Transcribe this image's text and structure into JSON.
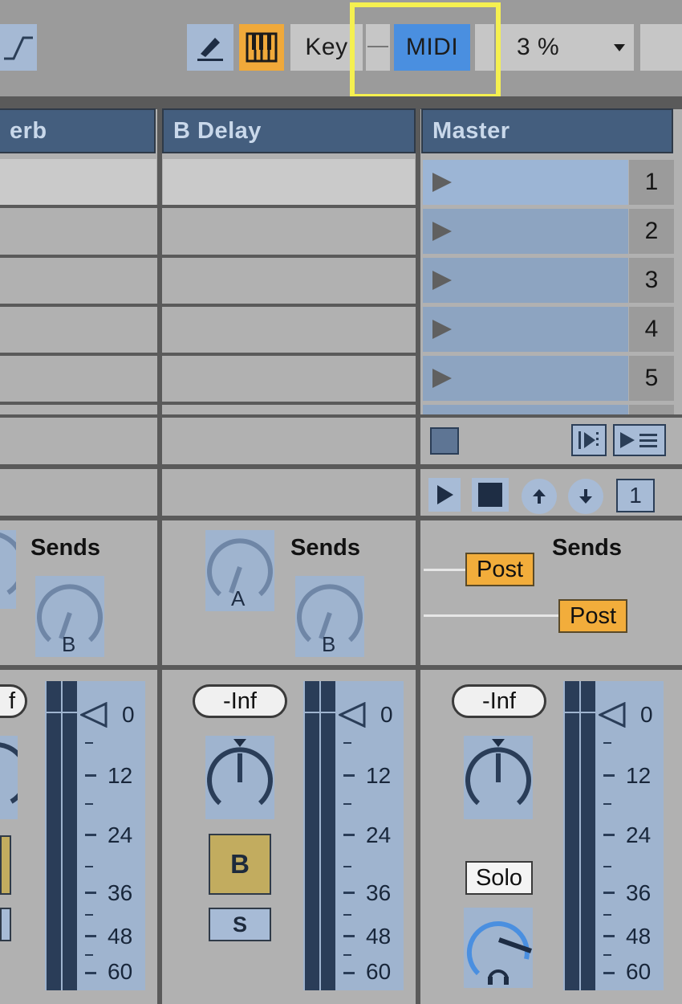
{
  "toolbar": {
    "draw_icon": "pencil-icon",
    "keyboard_icon": "piano-keys-icon",
    "envelope_icon": "curve-icon",
    "key_label": "Key",
    "midi_label": "MIDI",
    "percent_value": "3 %",
    "colors": {
      "midi_bg": "#4a8fe0",
      "keys_bg": "#f0a93a",
      "highlight": "#f5f050"
    }
  },
  "tracks": {
    "a_return_title_partial": "erb",
    "b_delay_title": "B Delay",
    "master_title": "Master"
  },
  "scenes": [
    "1",
    "2",
    "3",
    "4",
    "5"
  ],
  "master_controls": {
    "stop_all_icon": "stop-square-icon",
    "launch_scene_icon": "launch-scene-icon",
    "follow_icon": "play-list-icon",
    "play_icon": "play-icon",
    "stop_icon": "stop-icon",
    "up_icon": "arrow-up-icon",
    "down_icon": "arrow-down-icon",
    "scene_value": "1"
  },
  "sends": {
    "label": "Sends",
    "knob_a": "A",
    "knob_b": "B",
    "post_label": "Post"
  },
  "mixer": {
    "inf_partial": "f",
    "inf": "-Inf",
    "scale": [
      "0",
      "12",
      "24",
      "36",
      "48",
      "60"
    ],
    "crossfade_b": "B",
    "solo_s": "S",
    "solo_label": "Solo",
    "headphone_icon": "headphones-icon"
  }
}
